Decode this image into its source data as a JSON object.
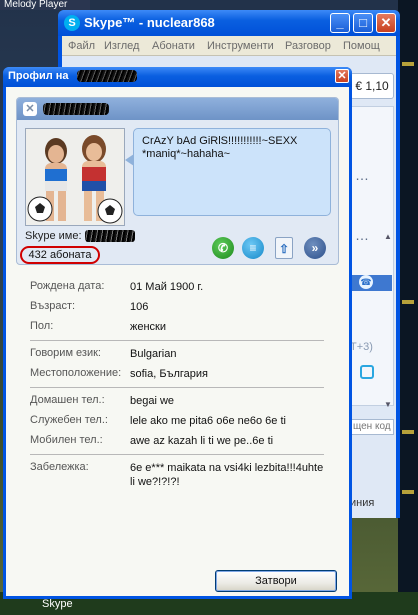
{
  "desktop": {
    "player_label": "Melody Player",
    "taskbar_label": "Skype"
  },
  "skype_window": {
    "title": "Skype™ - nuclear868",
    "menu": [
      "Файл",
      "Изглед",
      "Абонати",
      "Инструменти",
      "Разговор",
      "Помощ"
    ],
    "credit": "€ 1,10",
    "partial_plus": "T+3)",
    "search_placeholder": "щен код",
    "status_partial": "иния"
  },
  "profile_dialog": {
    "title": "Профил на",
    "mood_message": "CrAzY bAd GiRlS!!!!!!!!!!!~SEXX *maniq*~hahaha~",
    "skype_name_label": "Skype име:",
    "subscribers": "432 абоната",
    "fields": {
      "birth_date": {
        "label": "Рождена дата:",
        "value": "01 Май 1900 г."
      },
      "age": {
        "label": "Възраст:",
        "value": "106"
      },
      "gender": {
        "label": "Пол:",
        "value": "женски"
      },
      "language": {
        "label": "Говорим език:",
        "value": "Bulgarian"
      },
      "location": {
        "label": "Местоположение:",
        "value": "sofia, България"
      },
      "home_phone": {
        "label": "Домашен тел.:",
        "value": "begai we"
      },
      "office_phone": {
        "label": "Служебен тел.:",
        "value": "lele ako me pita6 o6e ne6o 6e ti"
      },
      "mobile_phone": {
        "label": "Мобилен тел.:",
        "value": "awe az kazah li ti we pe..6e ti"
      },
      "note": {
        "label": "Забележка:",
        "value": "6e e*** maikata na vsi4ki lezbita!!!4uhte li we?!?!?!"
      }
    },
    "close_button": "Затвори"
  }
}
